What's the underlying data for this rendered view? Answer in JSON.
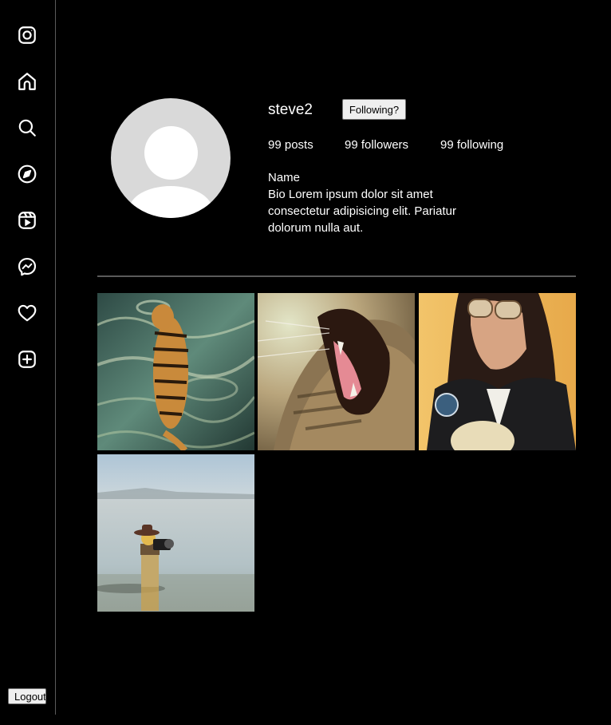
{
  "sidebar": {
    "items": [
      {
        "name": "instagram-icon"
      },
      {
        "name": "home-icon"
      },
      {
        "name": "search-icon"
      },
      {
        "name": "explore-compass-icon"
      },
      {
        "name": "reels-icon"
      },
      {
        "name": "messenger-icon"
      },
      {
        "name": "heart-icon"
      },
      {
        "name": "create-plus-icon"
      }
    ],
    "logout_label": "Logout"
  },
  "profile": {
    "username": "steve2",
    "follow_button_label": "Following?",
    "posts": "99 posts",
    "followers": "99 followers",
    "following": "99 following",
    "name": "Name",
    "bio": "Bio Lorem ipsum dolor sit amet consectetur adipisicing elit. Pariatur dolorum nulla aut."
  },
  "posts": [
    {
      "subject": "tiger-in-water"
    },
    {
      "subject": "yawning-tabby-cat"
    },
    {
      "subject": "woman-with-aviator-sunglasses-illustration"
    },
    {
      "subject": "toy-figure-with-camera-on-beach"
    }
  ],
  "colors": {
    "background": "#000000",
    "divider": "#5a5a5a",
    "button_bg": "#efefef",
    "avatar_bg": "#d9d9d9"
  }
}
